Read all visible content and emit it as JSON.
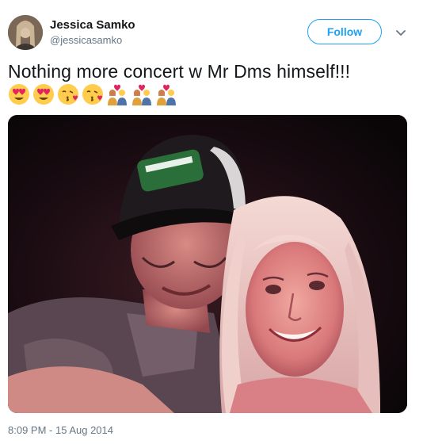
{
  "user": {
    "display_name": "Jessica Samko",
    "screen_name": "@jessicasamko",
    "avatar_icon": "profile-photo-avatar"
  },
  "actions": {
    "follow_label": "Follow",
    "more_icon": "chevron-down-icon"
  },
  "tweet": {
    "text": "Nothing more concert w Mr Dms himself!!!",
    "emojis": [
      "heart-eyes",
      "heart-eyes",
      "face-blowing-kiss",
      "face-blowing-kiss",
      "couple-with-heart",
      "couple-with-heart",
      "couple-with-heart"
    ],
    "photo": "selfie-of-man-in-cap-and-blonde-woman-at-concert",
    "timestamp": "8:09 PM - 15 Aug 2014"
  },
  "colors": {
    "accent": "#1da1f2",
    "secondary_text": "#657786",
    "primary_text": "#14171a"
  }
}
